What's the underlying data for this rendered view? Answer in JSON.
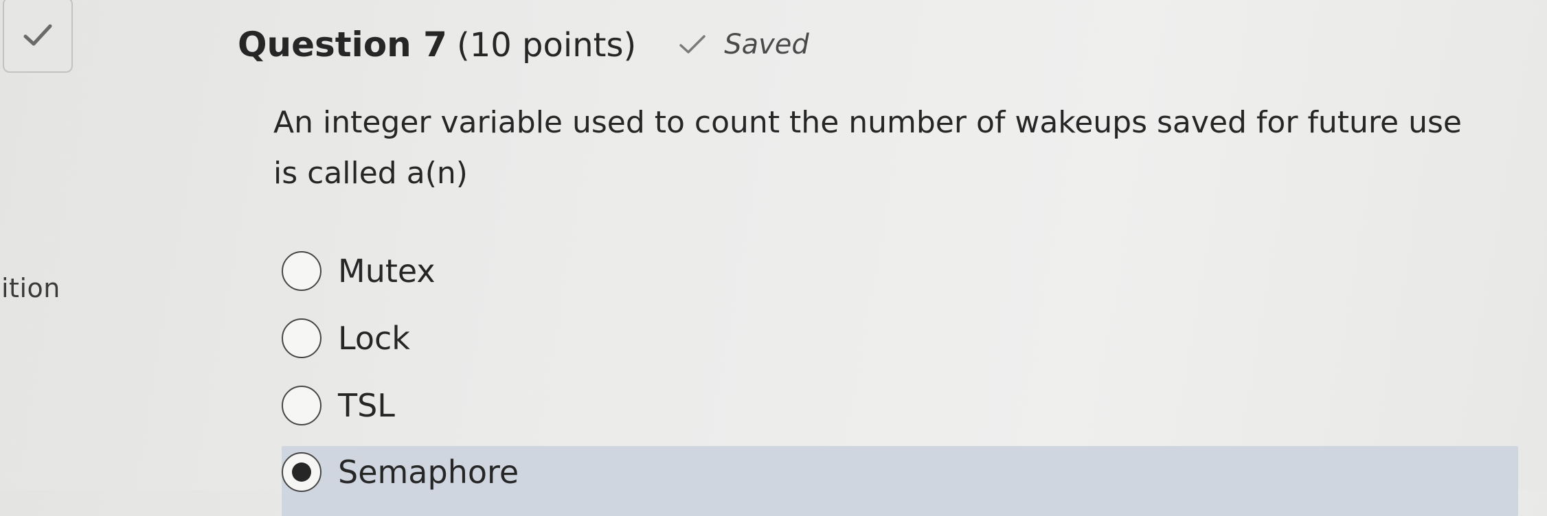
{
  "sidebar": {
    "status_icon": "check-icon",
    "partial_label": "ition"
  },
  "question": {
    "title": "Question 7",
    "points": "(10 points)",
    "status_icon": "check-icon",
    "status_text": "Saved",
    "text": "An integer variable used to count the number of wakeups saved for future use is called a(n)"
  },
  "options": [
    {
      "label": "Mutex",
      "selected": false
    },
    {
      "label": "Lock",
      "selected": false
    },
    {
      "label": "TSL",
      "selected": false
    },
    {
      "label": "Semaphore",
      "selected": true
    }
  ],
  "colors": {
    "selected_highlight": "#cfd6e0",
    "text": "#262626"
  }
}
